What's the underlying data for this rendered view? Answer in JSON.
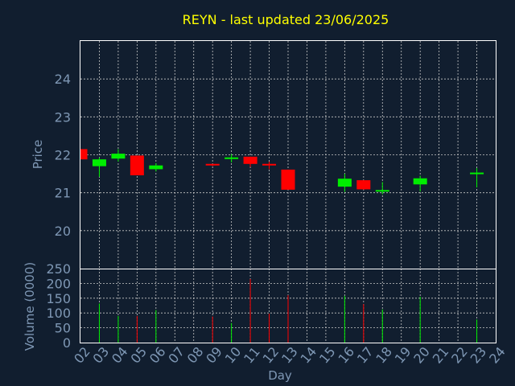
{
  "title": "REYN - last updated 23/06/2025",
  "colors": {
    "background": "#111e2f",
    "title": "#ffff00",
    "axis_text": "#7e97b4",
    "up": "#00ee00",
    "down": "#ff0000",
    "frame": "#ffffff",
    "grid": "#c8c8c8"
  },
  "chart_data": [
    {
      "type": "candlestick",
      "title": "REYN - last updated 23/06/2025",
      "ylabel": "Price",
      "xlim": [
        2,
        24
      ],
      "ylim": [
        19.0,
        25.0
      ],
      "yticks": [
        20,
        21,
        22,
        23,
        24
      ],
      "grid": true,
      "candles": [
        {
          "day": 2,
          "open": 22.15,
          "high": 22.15,
          "low": 21.88,
          "close": 21.88
        },
        {
          "day": 3,
          "open": 21.7,
          "high": 21.93,
          "low": 21.42,
          "close": 21.88
        },
        {
          "day": 4,
          "open": 21.9,
          "high": 22.15,
          "low": 21.82,
          "close": 22.03
        },
        {
          "day": 5,
          "open": 21.98,
          "high": 21.98,
          "low": 21.46,
          "close": 21.46
        },
        {
          "day": 6,
          "open": 21.62,
          "high": 21.78,
          "low": 21.56,
          "close": 21.72
        },
        {
          "day": 9,
          "open": 21.74,
          "high": 21.74,
          "low": 21.7,
          "close": 21.7
        },
        {
          "day": 10,
          "open": 21.88,
          "high": 22.02,
          "low": 21.8,
          "close": 21.91
        },
        {
          "day": 11,
          "open": 21.95,
          "high": 21.95,
          "low": 21.68,
          "close": 21.76
        },
        {
          "day": 12,
          "open": 21.74,
          "high": 21.82,
          "low": 21.62,
          "close": 21.72
        },
        {
          "day": 13,
          "open": 21.61,
          "high": 21.61,
          "low": 21.08,
          "close": 21.08
        },
        {
          "day": 16,
          "open": 21.16,
          "high": 21.5,
          "low": 21.02,
          "close": 21.37
        },
        {
          "day": 17,
          "open": 21.33,
          "high": 21.33,
          "low": 21.08,
          "close": 21.09
        },
        {
          "day": 18,
          "open": 21.04,
          "high": 21.28,
          "low": 20.96,
          "close": 21.05
        },
        {
          "day": 20,
          "open": 21.22,
          "high": 21.45,
          "low": 21.03,
          "close": 21.38
        },
        {
          "day": 23,
          "open": 21.5,
          "high": 21.65,
          "low": 21.14,
          "close": 21.51
        }
      ]
    },
    {
      "type": "bar",
      "ylabel": "Volume (0000)",
      "xlabel": "Day",
      "xlim": [
        2,
        24
      ],
      "ylim": [
        0,
        250
      ],
      "yticks": [
        0,
        50,
        100,
        150,
        200,
        250
      ],
      "grid": true,
      "xticks": [
        "02",
        "03",
        "04",
        "05",
        "06",
        "07",
        "08",
        "09",
        "10",
        "11",
        "12",
        "13",
        "14",
        "15",
        "16",
        "17",
        "18",
        "19",
        "20",
        "21",
        "22",
        "23",
        "24"
      ],
      "bars": [
        {
          "day": 3,
          "value": 132,
          "direction": "up"
        },
        {
          "day": 4,
          "value": 90,
          "direction": "up"
        },
        {
          "day": 5,
          "value": 90,
          "direction": "down"
        },
        {
          "day": 6,
          "value": 110,
          "direction": "up"
        },
        {
          "day": 9,
          "value": 88,
          "direction": "down"
        },
        {
          "day": 10,
          "value": 66,
          "direction": "up"
        },
        {
          "day": 11,
          "value": 215,
          "direction": "down"
        },
        {
          "day": 12,
          "value": 98,
          "direction": "down"
        },
        {
          "day": 13,
          "value": 160,
          "direction": "down"
        },
        {
          "day": 16,
          "value": 158,
          "direction": "up"
        },
        {
          "day": 17,
          "value": 130,
          "direction": "down"
        },
        {
          "day": 18,
          "value": 112,
          "direction": "up"
        },
        {
          "day": 20,
          "value": 155,
          "direction": "up"
        },
        {
          "day": 23,
          "value": 78,
          "direction": "up"
        }
      ]
    }
  ]
}
